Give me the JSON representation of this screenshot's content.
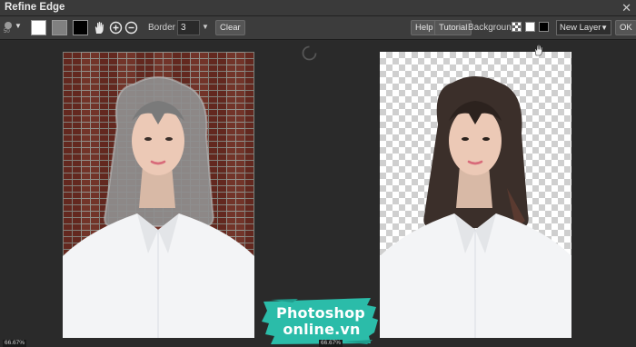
{
  "window": {
    "title": "Refine Edge",
    "close_glyph": "✕"
  },
  "toolbar": {
    "brush_size": "50",
    "border_label": "Border",
    "border_value": "3",
    "clear_label": "Clear",
    "help_label": "Help",
    "tutorial_label": "Tutorial",
    "background_label": "Background:",
    "layer_select_value": "New Layer",
    "ok_label": "OK",
    "swatch_colors": [
      "#ffffff",
      "#808080",
      "#000000"
    ]
  },
  "canvas": {
    "left_zoom": "66.67%",
    "right_zoom": "66.67%"
  },
  "watermark": {
    "line1": "Photoshop",
    "line2": "online.vn"
  },
  "colors": {
    "teal": "#2bbca9",
    "background": "#2b2b2b"
  }
}
